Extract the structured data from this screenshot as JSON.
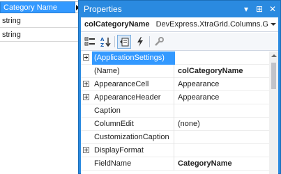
{
  "background_grid": {
    "column_header": "Category Name",
    "rows": [
      "string",
      "string"
    ]
  },
  "properties_window": {
    "title": "Properties",
    "title_buttons": {
      "dropdown": "▾",
      "pin": "⊞",
      "close": "✕"
    },
    "object": {
      "name": "colCategoryName",
      "type": "DevExpress.XtraGrid.Columns.GridColumn"
    },
    "toolbar": {
      "buttons": [
        "categorized-icon",
        "alphabetical-icon",
        "properties-icon",
        "events-icon",
        "property-pages-icon"
      ]
    },
    "rows": [
      {
        "name": "(ApplicationSettings)",
        "value": "",
        "expandable": true,
        "selected": true,
        "bold": false
      },
      {
        "name": "(Name)",
        "value": "colCategoryName",
        "expandable": false,
        "selected": false,
        "bold": true
      },
      {
        "name": "AppearanceCell",
        "value": "Appearance",
        "expandable": true,
        "selected": false,
        "bold": false
      },
      {
        "name": "AppearanceHeader",
        "value": "Appearance",
        "expandable": true,
        "selected": false,
        "bold": false
      },
      {
        "name": "Caption",
        "value": "",
        "expandable": false,
        "selected": false,
        "bold": false
      },
      {
        "name": "ColumnEdit",
        "value": "(none)",
        "expandable": false,
        "selected": false,
        "bold": false
      },
      {
        "name": "CustomizationCaption",
        "value": "",
        "expandable": false,
        "selected": false,
        "bold": false
      },
      {
        "name": "DisplayFormat",
        "value": "",
        "expandable": true,
        "selected": false,
        "bold": false
      },
      {
        "name": "FieldName",
        "value": "CategoryName",
        "expandable": false,
        "selected": false,
        "bold": true
      }
    ]
  },
  "colors": {
    "window_border": "#2a8ae0",
    "selection": "#3399ff"
  }
}
